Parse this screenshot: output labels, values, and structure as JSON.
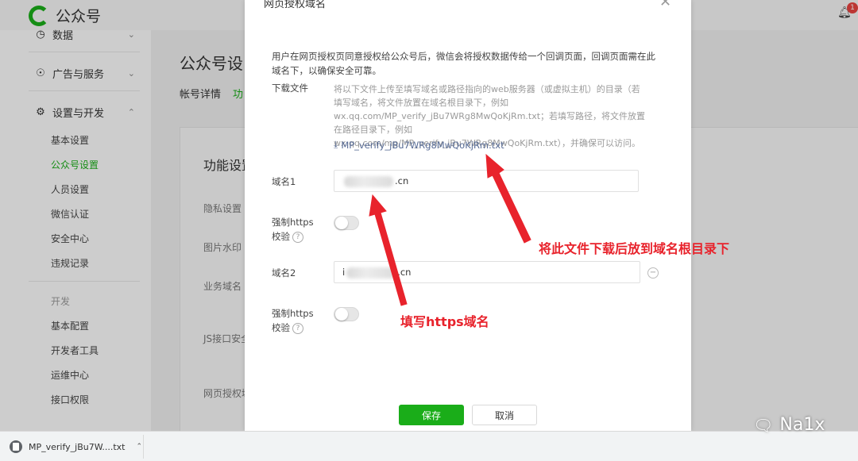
{
  "app": {
    "brand": "公众号",
    "notification_count": "1"
  },
  "sidebar": {
    "groups": [
      {
        "icon": "data-icon",
        "label": "数据"
      },
      {
        "icon": "compass-icon",
        "label": "广告与服务"
      },
      {
        "icon": "gear-icon",
        "label": "设置与开发"
      }
    ],
    "items_settings": [
      "基本设置",
      "公众号设置",
      "人员设置",
      "微信认证",
      "安全中心",
      "违规记录"
    ],
    "active_item": "公众号设置",
    "dev_section": "开发",
    "items_dev": [
      "基本配置",
      "开发者工具",
      "运维中心",
      "接口权限"
    ]
  },
  "main": {
    "page_title": "公众号设",
    "tab_account": "帐号详情",
    "tab_func": "功",
    "panel_title": "功能设置",
    "rows": [
      "隐私设置",
      "图片水印",
      "业务域名",
      "JS接口安全",
      "网页授权域"
    ]
  },
  "dialog": {
    "title": "网页授权域名",
    "intro": "用户在网页授权页同意授权给公众号后，微信会将授权数据传给一个回调页面，回调页面需在此域名下，以确保安全可靠。",
    "download_label": "下载文件",
    "download_desc": "将以下文件上传至填写域名或路径指向的web服务器（或虚拟主机）的目录（若填写域名，将文件放置在域名根目录下，例如wx.qq.com/MP_verify_jBu7WRg8MwQoKjRm.txt；若填写路径，将文件放置在路径目录下，例如wx.qq.com/mp/MP_verify_jBu7WRg8MwQoKjRm.txt），并确保可以访问。",
    "download_file": "MP_verify_jBu7WRg8MwQoKjRm.txt",
    "domain1_label": "域名1",
    "domain1_value": ".cn",
    "https_label": "强制https",
    "https_label2": "校验",
    "domain2_label": "域名2",
    "domain2_prefix": "i",
    "domain2_value": ".cn",
    "save": "保存",
    "cancel": "取消"
  },
  "annotations": {
    "download_hint": "将此文件下载后放到域名根目录下",
    "https_hint": "填写https域名",
    "color": "#e8232c"
  },
  "download_bar": {
    "file": "MP_verify_jBu7W....txt"
  },
  "watermark": "Na1x",
  "colors": {
    "accent": "#1aad19",
    "link": "#576b95"
  }
}
